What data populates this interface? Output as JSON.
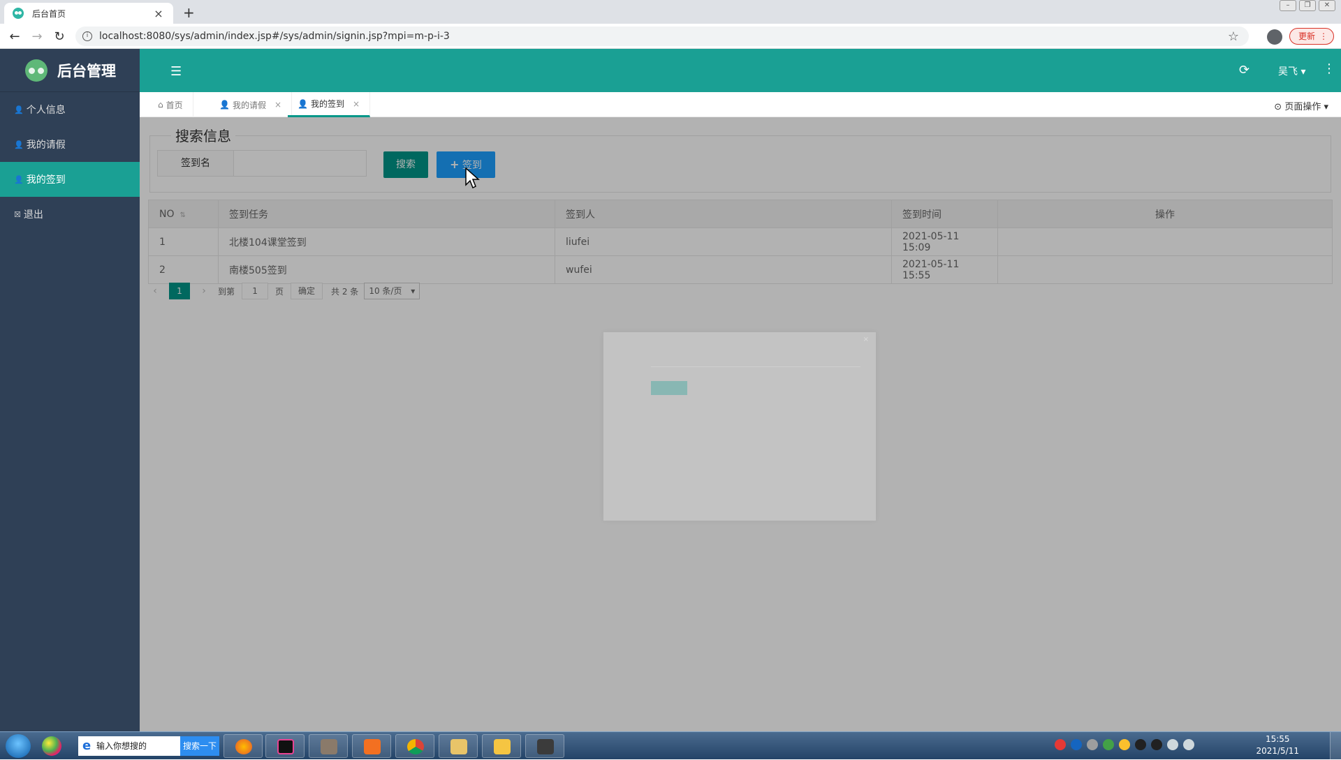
{
  "browser": {
    "tab_title": "后台首页",
    "tab_close": "×",
    "new_tab": "+",
    "url": "localhost:8080/sys/admin/index.jsp#/sys/admin/signin.jsp?mpi=m-p-i-3",
    "update_label": "更新"
  },
  "sidebar": {
    "title": "后台管理",
    "items": [
      {
        "label": "个人信息",
        "icon": "user-icon"
      },
      {
        "label": "我的请假",
        "icon": "user-icon"
      },
      {
        "label": "我的签到",
        "icon": "user-icon",
        "active": true
      },
      {
        "label": "退出",
        "icon": "close-box-icon"
      }
    ]
  },
  "header": {
    "user_name": "吴飞"
  },
  "tabs": [
    {
      "label": "首页",
      "icon": "home-icon"
    },
    {
      "label": "我的请假",
      "icon": "user-icon",
      "closable": true
    },
    {
      "label": "我的签到",
      "icon": "user-icon",
      "closable": true,
      "active": true
    }
  ],
  "tab_close_glyph": "×",
  "page_ops": "页面操作",
  "search": {
    "legend": "搜索信息",
    "field_label": "签到名",
    "input_value": "",
    "search_button": "搜索",
    "add_button": "签到"
  },
  "table": {
    "columns": [
      "NO",
      "签到任务",
      "签到人",
      "签到时间",
      "操作"
    ],
    "rows": [
      [
        "1",
        "北楼104课堂签到",
        "liufei",
        "2021-05-11 15:09",
        ""
      ],
      [
        "2",
        "南楼505签到",
        "wufei",
        "2021-05-11 15:55",
        ""
      ]
    ]
  },
  "pager": {
    "current_page": "1",
    "goto_label": "到第",
    "goto_value": "1",
    "page_label": "页",
    "confirm": "确定",
    "total": "共 2 条",
    "page_size": "10 条/页"
  },
  "taskbar": {
    "search_placeholder": "输入你想搜的",
    "search_button": "搜索一下",
    "time": "15:55",
    "date": "2021/5/11"
  },
  "colors": {
    "primary": "#1aa094",
    "sidebar": "#2f4056",
    "add_button": "#1e9fff",
    "search_button": "#009688"
  }
}
